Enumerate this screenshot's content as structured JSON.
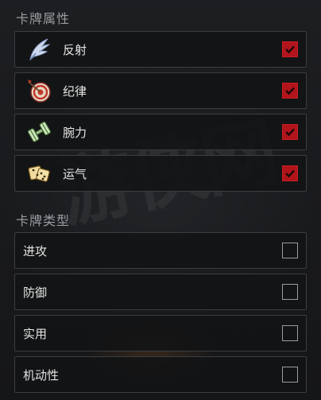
{
  "card_attributes": {
    "title": "卡牌属性",
    "items": [
      {
        "label": "反射",
        "icon": "wing-icon",
        "checked": true
      },
      {
        "label": "纪律",
        "icon": "target-icon",
        "checked": true
      },
      {
        "label": "腕力",
        "icon": "dumbbell-icon",
        "checked": true
      },
      {
        "label": "运气",
        "icon": "dice-icon",
        "checked": true
      }
    ]
  },
  "card_types": {
    "title": "卡牌类型",
    "items": [
      {
        "label": "进攻",
        "checked": false
      },
      {
        "label": "防御",
        "checked": false
      },
      {
        "label": "实用",
        "checked": false
      },
      {
        "label": "机动性",
        "checked": false
      }
    ]
  },
  "colors": {
    "checkbox_checked": "#b1141a",
    "row_border": "#3b3d41",
    "title_text": "#9a9ca0"
  }
}
